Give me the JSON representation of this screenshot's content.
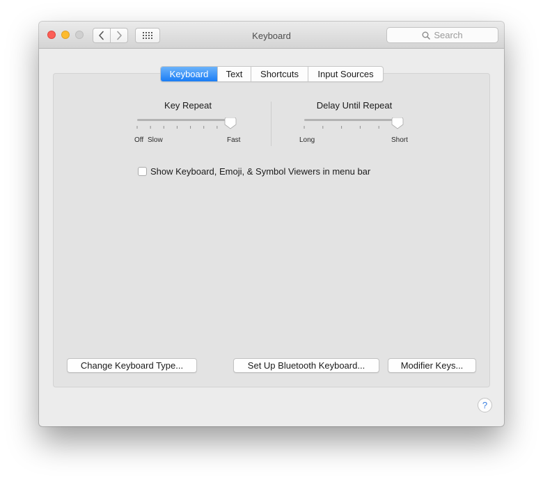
{
  "window": {
    "title": "Keyboard",
    "search_placeholder": "Search"
  },
  "toolbar": {
    "back_icon": "chevron-left-icon",
    "forward_icon": "chevron-right-icon",
    "grid_icon": "show-all-grid-icon"
  },
  "tabs": [
    {
      "label": "Keyboard",
      "selected": true
    },
    {
      "label": "Text",
      "selected": false
    },
    {
      "label": "Shortcuts",
      "selected": false
    },
    {
      "label": "Input Sources",
      "selected": false
    }
  ],
  "key_repeat": {
    "label": "Key Repeat",
    "min_label": "Off",
    "slow_label": "Slow",
    "max_label": "Fast",
    "value_fraction": 1.0
  },
  "delay_until_repeat": {
    "label": "Delay Until Repeat",
    "min_label": "Long",
    "max_label": "Short",
    "value_fraction": 1.0
  },
  "options": {
    "show_viewers_label": "Show Keyboard, Emoji, & Symbol Viewers in menu bar",
    "show_viewers_checked": false
  },
  "buttons": {
    "change_keyboard_type": "Change Keyboard Type...",
    "bluetooth_keyboard": "Set Up Bluetooth Keyboard...",
    "modifier_keys": "Modifier Keys..."
  },
  "help": {
    "label": "?"
  },
  "colors": {
    "accent": "#1b7df5",
    "close": "#fc5f57",
    "minimize": "#fdbb2e",
    "zoom_disabled": "#d0d0d0"
  }
}
